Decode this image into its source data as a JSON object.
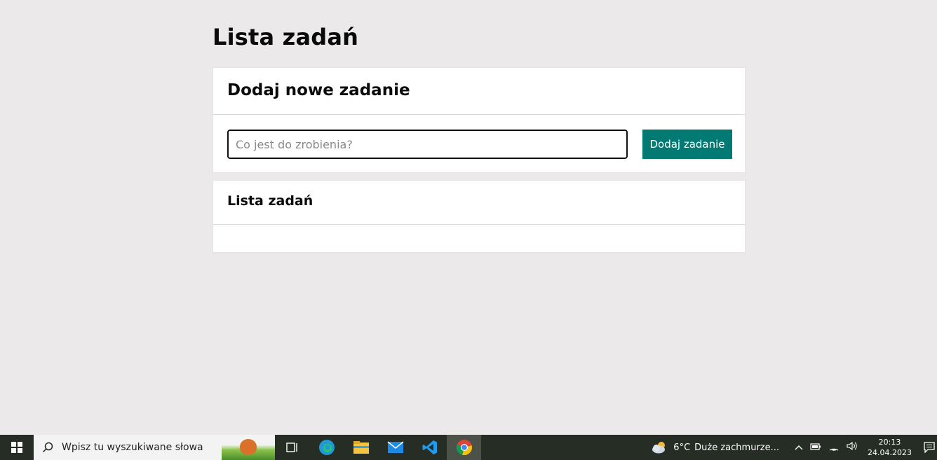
{
  "page": {
    "title": "Lista zadań"
  },
  "add_card": {
    "heading": "Dodaj nowe zadanie",
    "input_placeholder": "Co jest do zrobienia?",
    "input_value": "",
    "button_label": "Dodaj zadanie",
    "accent_color": "#007a73"
  },
  "list_card": {
    "heading": "Lista zadań",
    "items": []
  },
  "taskbar": {
    "search_placeholder": "Wpisz tu wyszukiwane słowa",
    "apps": [
      "task-view-icon",
      "edge-icon",
      "file-explorer-icon",
      "mail-icon",
      "vscode-icon",
      "chrome-icon"
    ],
    "weather": {
      "temperature": "6°C",
      "description": "Duże zachmurze..."
    },
    "time": "20:13",
    "date": "24.04.2023"
  }
}
